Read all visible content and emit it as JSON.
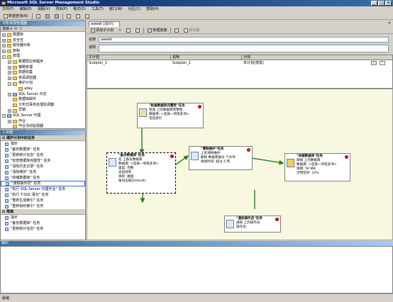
{
  "window": {
    "title": "Microsoft SQL Server Management Studio",
    "min": "_",
    "max": "□",
    "close": "×"
  },
  "menu": [
    "文件(F)",
    "编辑(E)",
    "视图(V)",
    "项目(P)",
    "格式(O)",
    "工具(T)",
    "窗口(W)",
    "社区(C)",
    "帮助(H)"
  ],
  "toolbar": {
    "new_query": "新建查询(N)"
  },
  "object_explorer": {
    "title": "对象资源管理器",
    "connect": "连接 ▾",
    "nodes": [
      {
        "label": "数据库",
        "indent": 1,
        "box": "+"
      },
      {
        "label": "安全性",
        "indent": 1,
        "box": "+"
      },
      {
        "label": "服务器对象",
        "indent": 1,
        "box": "+"
      },
      {
        "label": "复制",
        "indent": 1,
        "box": "+"
      },
      {
        "label": "管理",
        "indent": 1,
        "box": "−"
      },
      {
        "label": "数据层应用程序",
        "indent": 2,
        "box": "+"
      },
      {
        "label": "策略管理",
        "indent": 2,
        "box": "+"
      },
      {
        "label": "数据收集",
        "indent": 2,
        "box": "+"
      },
      {
        "label": "资源调控器",
        "indent": 2,
        "box": "+"
      },
      {
        "label": "维护计划",
        "indent": 2,
        "box": "−"
      },
      {
        "label": "aday",
        "indent": 3,
        "box": ""
      },
      {
        "label": "SQL Server 日志",
        "indent": 2,
        "box": "+"
      },
      {
        "label": "数据库邮件",
        "indent": 2,
        "box": ""
      },
      {
        "label": "分布式事务处理协调器",
        "indent": 2,
        "box": ""
      },
      {
        "label": "早期",
        "indent": 2,
        "box": "+"
      },
      {
        "label": "SQL Server 代理",
        "indent": 1,
        "box": "−"
      },
      {
        "label": "作业",
        "indent": 2,
        "box": "+"
      },
      {
        "label": "作业活动监视器",
        "indent": 2,
        "box": ""
      },
      {
        "label": "警报",
        "indent": 2,
        "box": "+"
      }
    ]
  },
  "toolbox": {
    "title": "工具箱",
    "group1": "维护计划中的任务",
    "items1": [
      "指针",
      "\"备份数据库\" 任务",
      "\"更新统计信息\" 任务",
      "\"检查数据库完整性\" 任务",
      "\"清除历史记录\" 任务",
      "\"清除维护\" 任务",
      "\"收缩数据库\" 任务",
      "\"通知操作员\" 任务",
      "\"执行 SQL Server 代理作业\" 任务",
      "\"执行 T-SQL 语句\" 任务",
      "\"重新生成索引\" 任务",
      "\"重新组织索引\" 任务"
    ],
    "selected_index": 7,
    "group2": "常规",
    "items2": [
      "指针",
      "\"备份数据库\" 任务",
      "\"更新统计信息\" 任务"
    ]
  },
  "designer": {
    "tab": "aweek [设计]",
    "tools": [
      "添加子计划",
      "×",
      "",
      "",
      "管理连接",
      "",
      "",
      "服务器"
    ],
    "name_label": "名称",
    "name_value": "aweek",
    "desc_label": "说明",
    "grid_headers": [
      "子计划",
      "说明",
      "计划"
    ],
    "grid_row": [
      "Subplan_1",
      "Subplan_1",
      "未计划(按需)"
    ]
  },
  "tasks": {
    "check": {
      "title": "\"检查数据库完整性\"任务",
      "lines": [
        "检查 上的数据库完整性",
        "数据库: <选择一项或多项>",
        "包括索引"
      ]
    },
    "backup": {
      "title": "\"备份数据库\"任务",
      "lines": [
        "在 上备份数据库",
        "数据库: <选择一项或多项>",
        "类型: 完整",
        "追加现有",
        "目标: 磁盘",
        "备份压缩(Default)"
      ]
    },
    "cleanup": {
      "title": "\"清除维护\"任务",
      "lines": [
        "上的清除维护",
        "删除 数据库备份 个文件",
        "保留时间: 超过 4 周"
      ]
    },
    "shrink": {
      "title": "\"收缩数据库\"任务",
      "lines": [
        "收缩 上的数据库",
        "数据库: <选择一项或多项>",
        "限制: 50 MB",
        "可用空间: 10%"
      ]
    },
    "notify": {
      "title": "\"通知操作员\"任务",
      "lines": [
        "通知 上的操作员",
        "操作员:"
      ]
    }
  },
  "output": {
    "title": "输出"
  },
  "status": {
    "text": "就绪"
  }
}
